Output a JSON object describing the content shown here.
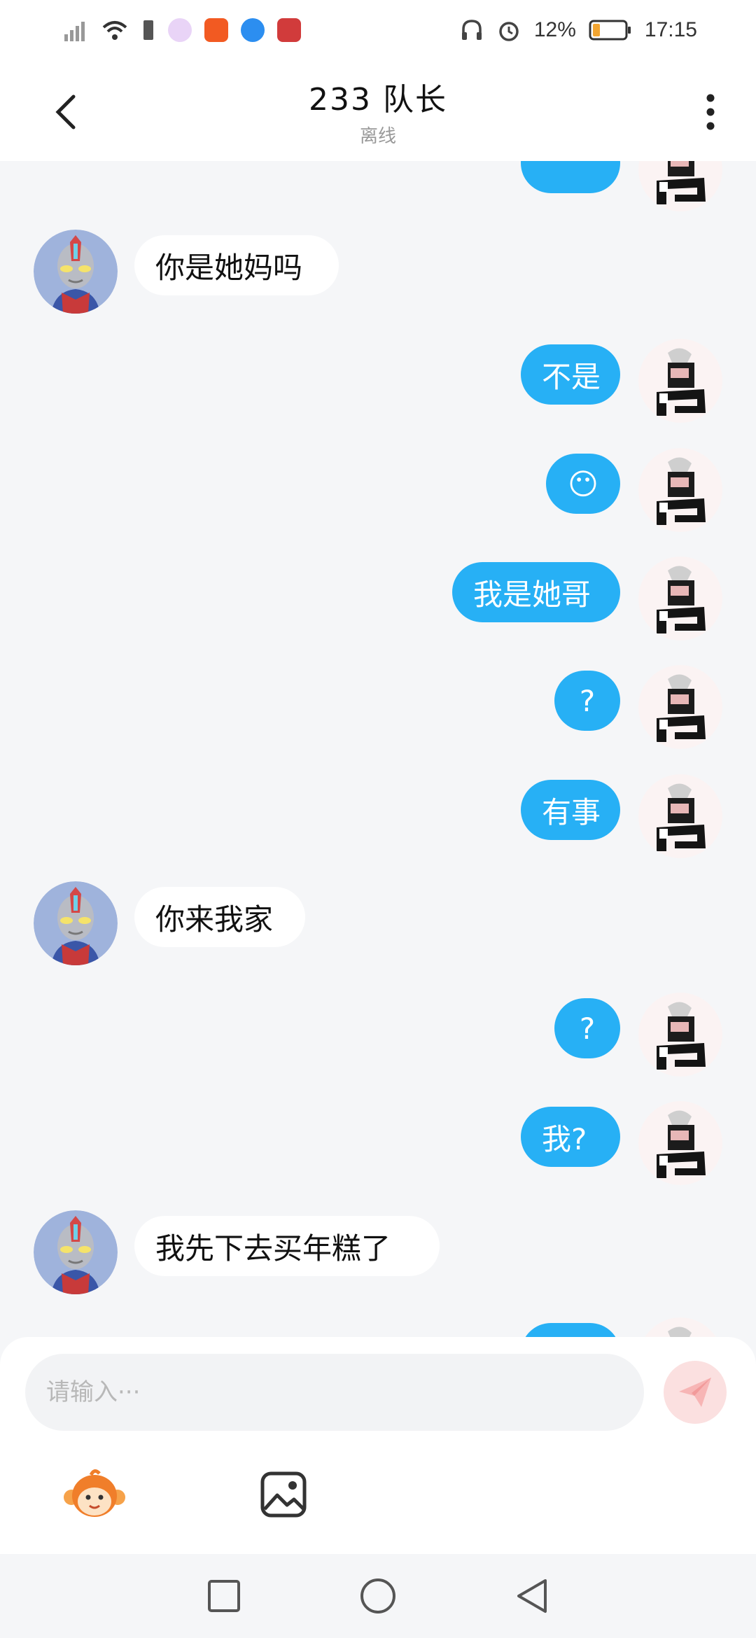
{
  "status_bar": {
    "battery": "12%",
    "time": "17:15"
  },
  "header": {
    "title": "233 队长",
    "subtitle": "离线"
  },
  "messages": [
    {
      "side": "out",
      "text": "",
      "partial": true
    },
    {
      "side": "in",
      "text": "你是她妈吗"
    },
    {
      "side": "out",
      "text": "不是"
    },
    {
      "side": "out",
      "text": "😶"
    },
    {
      "side": "out",
      "text": "我是她哥"
    },
    {
      "side": "out",
      "text": "?"
    },
    {
      "side": "out",
      "text": "有事"
    },
    {
      "side": "in",
      "text": "你来我家"
    },
    {
      "side": "out",
      "text": "?"
    },
    {
      "side": "out",
      "text": "我?"
    },
    {
      "side": "in",
      "text": "我先下去买年糕了"
    },
    {
      "side": "out",
      "text": "",
      "partial": true
    }
  ],
  "input": {
    "placeholder": "请输入···"
  },
  "colors": {
    "accent": "#27b0f5",
    "background": "#f5f6f8"
  },
  "icons": {
    "back": "back-arrow-icon",
    "more": "more-vertical-icon",
    "send": "send-icon",
    "sticker": "monkey-sticker-icon",
    "image": "image-icon"
  }
}
